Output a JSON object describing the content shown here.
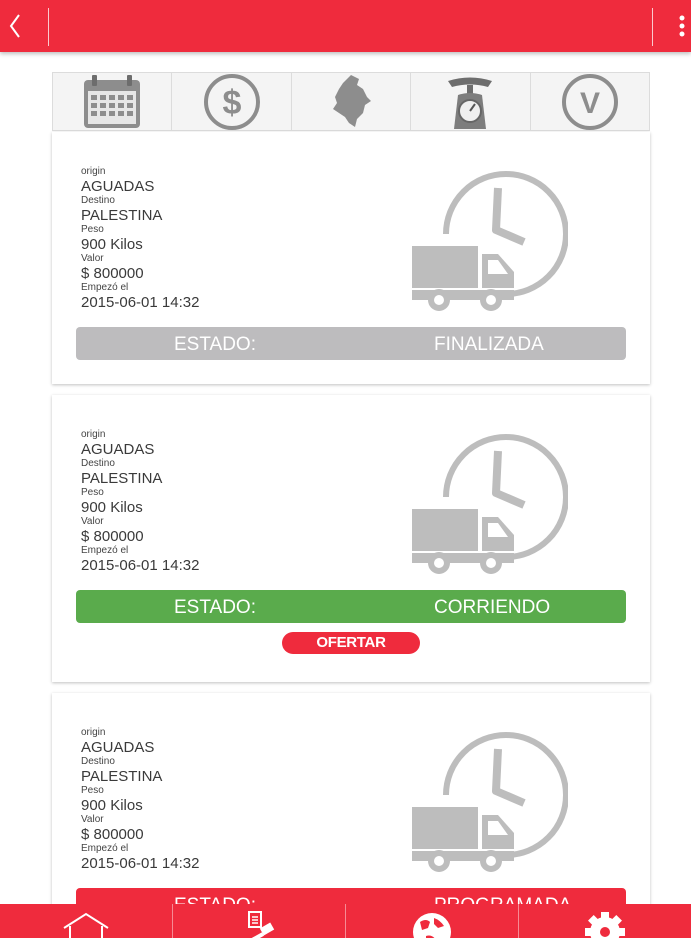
{
  "colors": {
    "brand": "#ef2b3d",
    "finalizada": "#bdbcbe",
    "corriendo": "#5aab4c",
    "programada": "#ef2b3d"
  },
  "header": {
    "back_icon": "chevron-left-icon",
    "menu_icon": "overflow-menu-icon"
  },
  "filters": [
    "calendar-icon",
    "dollar-icon",
    "colombia-map-icon",
    "scale-icon",
    "v-circle-icon"
  ],
  "labels": {
    "origin": "origin",
    "destino": "Destino",
    "peso": "Peso",
    "valor": "Valor",
    "empezo": "Empezó el",
    "estado": "ESTADO:"
  },
  "shipments": [
    {
      "origin": "AGUADAS",
      "destino": "PALESTINA",
      "peso": "900 Kilos",
      "valor": "$ 800000",
      "empezo": "2015-06-01 14:32",
      "status": "FINALIZADA"
    },
    {
      "origin": "AGUADAS",
      "destino": "PALESTINA",
      "peso": "900 Kilos",
      "valor": "$ 800000",
      "empezo": "2015-06-01 14:32",
      "status": "CORRIENDO",
      "action": "OFERTAR"
    },
    {
      "origin": "AGUADAS",
      "destino": "PALESTINA",
      "peso": "900 Kilos",
      "valor": "$ 800000",
      "empezo": "2015-06-01 14:32",
      "status": "PROGRAMADA"
    }
  ],
  "bottom_nav": [
    "home-icon",
    "auction-icon",
    "globe-icon",
    "settings-icon"
  ]
}
